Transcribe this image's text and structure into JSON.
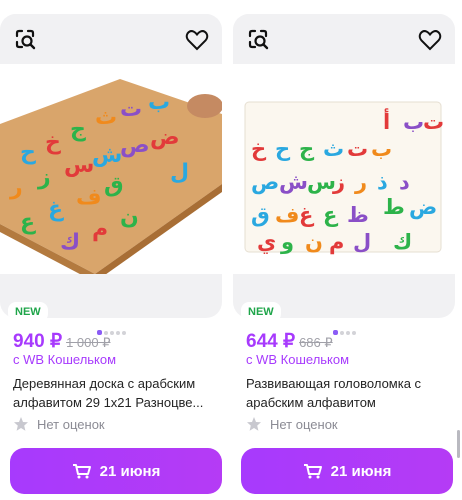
{
  "cards": [
    {
      "badge": "NEW",
      "price": "940 ₽",
      "old_price": "1 000 ₽",
      "wallet": "с WB Кошельком",
      "title": "Деревянная доска с арабским алфавитом 29 1х21 Разноцве...",
      "rating": "Нет оценок",
      "button": "21 июня"
    },
    {
      "badge": "NEW",
      "price": "644 ₽",
      "old_price": "686 ₽",
      "wallet": "с WB Кошельком",
      "title": "Развивающая головоломка с арабским алфавитом",
      "rating": "Нет оценок",
      "button": "21 июня"
    }
  ],
  "colors": {
    "accent": "#a73afd",
    "new_badge": "#1fa54a",
    "muted": "#8b8b94"
  },
  "icons": [
    "image-search-icon",
    "heart-icon",
    "star-icon",
    "cart-icon"
  ]
}
